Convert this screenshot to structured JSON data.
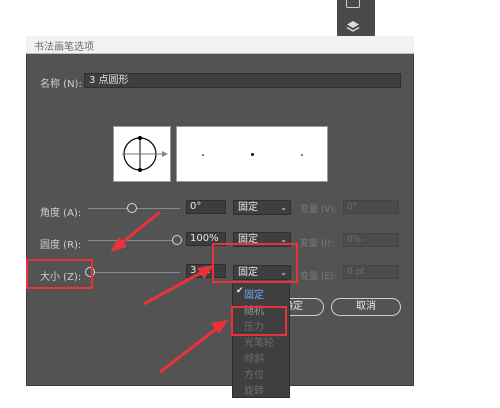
{
  "dialog": {
    "title": "书法画笔选项",
    "name_label": "名称 (N):",
    "name_value": "3 点圆形",
    "ok_label": "确定",
    "cancel_label": "取消"
  },
  "rows": {
    "angle": {
      "label": "角度 (A):",
      "value": "0°",
      "mode": "固定",
      "var_label": "变量 (V):",
      "var_value": "0°"
    },
    "roundness": {
      "label": "圆度 (R):",
      "value": "100%",
      "mode": "固定",
      "var_label": "变量 (I):",
      "var_value": "0%"
    },
    "size": {
      "label": "大小 (Z):",
      "value": "3 pt",
      "mode": "固定",
      "var_label": "变量 (E):",
      "var_value": "0 pt"
    }
  },
  "dropdown": {
    "options": [
      "固定",
      "随机",
      "压力",
      "光笔轮",
      "倾斜",
      "方位",
      "旋转"
    ],
    "selected": "固定"
  },
  "colors": {
    "annotation": "#e8333a",
    "dialog_bg": "#535353",
    "selected_option": "#6aa8ff"
  }
}
